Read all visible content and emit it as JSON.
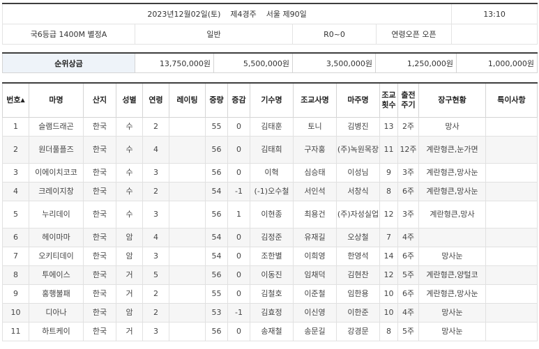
{
  "race": {
    "date_line": "2023년12월02일(토)    제4경주    서울 제90일",
    "time": "13:10",
    "grade_distance": "국6등급  1400M  별정A",
    "type": "일반",
    "rating": "R0~0",
    "age_condition": "연령오픈 오픈"
  },
  "prize": {
    "label": "순위상금",
    "values": [
      "13,750,000원",
      "5,500,000원",
      "3,500,000원",
      "1,250,000원",
      "1,000,000원"
    ]
  },
  "table": {
    "headers": {
      "no": "번호",
      "horse": "마명",
      "origin": "산지",
      "sex": "성별",
      "age": "연령",
      "rating": "레이팅",
      "weight": "중량",
      "delta": "증감",
      "jockey": "기수명",
      "trainer": "조교사명",
      "owner": "마주명",
      "training": "조교 횟수",
      "cycle": "출전 주기",
      "gear": "장구현황",
      "notes": "특이사항"
    },
    "sort_icon": "▲",
    "rows": [
      {
        "no": "1",
        "horse": "슬램드래곤",
        "origin": "한국",
        "sex": "수",
        "age": "2",
        "rating": "",
        "weight": "55",
        "delta": "0",
        "jockey": "김태훈",
        "trainer": "토니",
        "owner": "김병진",
        "training": "13",
        "cycle": "2주",
        "gear": "망사",
        "notes": ""
      },
      {
        "no": "2",
        "horse": "원더풀플즈",
        "origin": "한국",
        "sex": "수",
        "age": "4",
        "rating": "",
        "weight": "56",
        "delta": "0",
        "jockey": "김태희",
        "trainer": "구자홍",
        "owner": "(주)녹원목장",
        "training": "11",
        "cycle": "12주",
        "gear": "계란형큰,눈가면",
        "notes": ""
      },
      {
        "no": "3",
        "horse": "이에이치코코",
        "origin": "한국",
        "sex": "수",
        "age": "3",
        "rating": "",
        "weight": "56",
        "delta": "0",
        "jockey": "이혁",
        "trainer": "심승태",
        "owner": "이성님",
        "training": "9",
        "cycle": "3주",
        "gear": "계란형큰,망사눈",
        "notes": ""
      },
      {
        "no": "4",
        "horse": "크레이지창",
        "origin": "한국",
        "sex": "수",
        "age": "2",
        "rating": "",
        "weight": "54",
        "delta": "-1",
        "jockey": "(-1)오수철",
        "trainer": "서인석",
        "owner": "서창식",
        "training": "8",
        "cycle": "6주",
        "gear": "계란형큰,망사눈",
        "notes": ""
      },
      {
        "no": "5",
        "horse": "누리데이",
        "origin": "한국",
        "sex": "수",
        "age": "3",
        "rating": "",
        "weight": "56",
        "delta": "1",
        "jockey": "이현종",
        "trainer": "최용건",
        "owner": "(주)자성실업",
        "training": "12",
        "cycle": "3주",
        "gear": "계란형큰,망사",
        "notes": ""
      },
      {
        "no": "6",
        "horse": "헤이마마",
        "origin": "한국",
        "sex": "암",
        "age": "4",
        "rating": "",
        "weight": "54",
        "delta": "0",
        "jockey": "김정준",
        "trainer": "유재길",
        "owner": "오상철",
        "training": "7",
        "cycle": "4주",
        "gear": "",
        "notes": ""
      },
      {
        "no": "7",
        "horse": "오키티데이",
        "origin": "한국",
        "sex": "암",
        "age": "3",
        "rating": "",
        "weight": "54",
        "delta": "0",
        "jockey": "조한별",
        "trainer": "이희영",
        "owner": "한영석",
        "training": "14",
        "cycle": "6주",
        "gear": "망사눈",
        "notes": ""
      },
      {
        "no": "8",
        "horse": "투에이스",
        "origin": "한국",
        "sex": "거",
        "age": "5",
        "rating": "",
        "weight": "56",
        "delta": "0",
        "jockey": "이동진",
        "trainer": "임채덕",
        "owner": "김현찬",
        "training": "12",
        "cycle": "5주",
        "gear": "계란형큰,양털코",
        "notes": ""
      },
      {
        "no": "9",
        "horse": "홍행불패",
        "origin": "한국",
        "sex": "거",
        "age": "2",
        "rating": "",
        "weight": "55",
        "delta": "0",
        "jockey": "김철호",
        "trainer": "이준철",
        "owner": "임한용",
        "training": "10",
        "cycle": "6주",
        "gear": "계란형큰,망사눈",
        "notes": ""
      },
      {
        "no": "10",
        "horse": "디아나",
        "origin": "한국",
        "sex": "암",
        "age": "2",
        "rating": "",
        "weight": "53",
        "delta": "-1",
        "jockey": "김효정",
        "trainer": "이신영",
        "owner": "이한준",
        "training": "10",
        "cycle": "4주",
        "gear": "망사눈",
        "notes": ""
      },
      {
        "no": "11",
        "horse": "하트케이",
        "origin": "한국",
        "sex": "거",
        "age": "3",
        "rating": "",
        "weight": "56",
        "delta": "0",
        "jockey": "송재철",
        "trainer": "송문길",
        "owner": "강경문",
        "training": "8",
        "cycle": "5주",
        "gear": "망사눈",
        "notes": ""
      }
    ]
  }
}
